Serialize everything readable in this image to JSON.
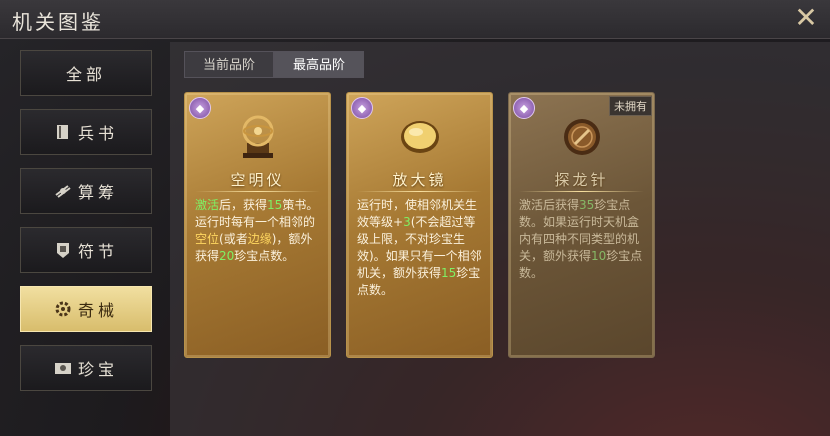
{
  "header": {
    "title": "机关图鉴"
  },
  "sidebar": {
    "items": [
      {
        "label": "全部",
        "icon": "all"
      },
      {
        "label": "兵书",
        "icon": "book-icon"
      },
      {
        "label": "算筹",
        "icon": "counting-rods-icon"
      },
      {
        "label": "符节",
        "icon": "token-icon"
      },
      {
        "label": "奇械",
        "icon": "gear-icon",
        "active": true
      },
      {
        "label": "珍宝",
        "icon": "treasure-icon"
      }
    ]
  },
  "tabs": [
    {
      "label": "当前品阶"
    },
    {
      "label": "最高品阶",
      "active": true
    }
  ],
  "cards": [
    {
      "name": "空明仪",
      "quality_icon": "purple-quality-icon",
      "owned": true,
      "desc": {
        "p1": "激活",
        "p2": "后，获得",
        "n1": "15",
        "p3": "策书",
        "p4": "。运行时每有一个相邻的",
        "h1": "空位",
        "p5": "(或者",
        "h2": "边缘",
        "p6": ")，额外获得",
        "n2": "20",
        "p7": "珍宝点数。"
      }
    },
    {
      "name": "放大镜",
      "quality_icon": "purple-quality-icon",
      "owned": true,
      "desc": {
        "p1": "运行时，使相邻机关生效等级+",
        "n1": "3",
        "p2": "(不会超过等级上限，不对珍宝生效)。如果只有一个相邻机关，额外获得",
        "n2": "15",
        "p3": "珍宝点数。"
      }
    },
    {
      "name": "探龙针",
      "quality_icon": "purple-quality-icon",
      "owned": false,
      "tag": "未拥有",
      "desc": {
        "p1": "激活后获得",
        "n1": "35",
        "p2": "珍宝点数。如果运行时天机盒内有四种不同类型的机关，额外获得",
        "n2": "10",
        "p3": "珍宝点数。"
      }
    }
  ],
  "colors": {
    "highlight_green": "#7ff064",
    "highlight_yellow": "#ffd760",
    "active_tab": "#d8bd6c"
  }
}
